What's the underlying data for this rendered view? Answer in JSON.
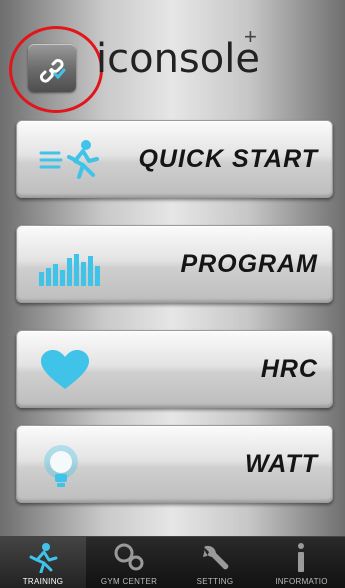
{
  "header": {
    "logo_text": "iconsole",
    "logo_sup": "+",
    "connect_icon": "link-icon"
  },
  "menu": [
    {
      "label": "QUICK START",
      "icon": "running-man-icon"
    },
    {
      "label": "PROGRAM",
      "icon": "bar-graph-icon"
    },
    {
      "label": "HRC",
      "icon": "heart-icon"
    },
    {
      "label": "WATT",
      "icon": "lightbulb-icon"
    }
  ],
  "tabs": [
    {
      "label": "TRAINING",
      "icon": "runner-icon",
      "active": true
    },
    {
      "label": "GYM CENTER",
      "icon": "gym-icon",
      "active": false
    },
    {
      "label": "SETTING",
      "icon": "wrench-icon",
      "active": false
    },
    {
      "label": "INFORMATIO",
      "icon": "info-icon",
      "active": false
    }
  ],
  "colors": {
    "accent_cyan": "#3fc3e8",
    "highlight_red": "#e0161b"
  }
}
